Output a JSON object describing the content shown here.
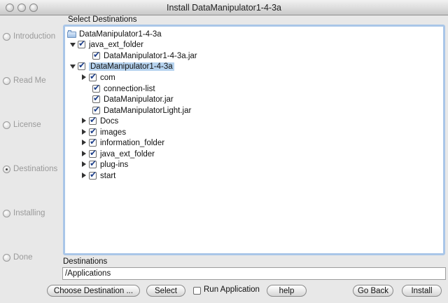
{
  "window": {
    "title": "Install DataManipulator1-4-3a"
  },
  "steps": [
    {
      "label": "Introduction",
      "selected": false
    },
    {
      "label": "Read Me",
      "selected": false
    },
    {
      "label": "License",
      "selected": false
    },
    {
      "label": "Destinations",
      "selected": true
    },
    {
      "label": "Installing",
      "selected": false
    },
    {
      "label": "Done",
      "selected": false
    }
  ],
  "tree": {
    "heading": "Select Destinations",
    "root_label": "DataManipulator1-4-3a",
    "items": [
      {
        "label": "java_ext_folder",
        "checked": true,
        "expander": "down"
      },
      {
        "label": "DataManipulator1-4-3a.jar",
        "checked": true,
        "expander": "none"
      },
      {
        "label": "DataManipulator1-4-3a",
        "checked": true,
        "expander": "down",
        "selected": true
      },
      {
        "label": "com",
        "checked": true,
        "expander": "right"
      },
      {
        "label": "connection-list",
        "checked": true,
        "expander": "none"
      },
      {
        "label": "DataManipulator.jar",
        "checked": true,
        "expander": "none"
      },
      {
        "label": "DataManipulatorLight.jar",
        "checked": true,
        "expander": "none"
      },
      {
        "label": "Docs",
        "checked": true,
        "expander": "right"
      },
      {
        "label": "images",
        "checked": true,
        "expander": "right"
      },
      {
        "label": "information_folder",
        "checked": true,
        "expander": "right"
      },
      {
        "label": "java_ext_folder",
        "checked": true,
        "expander": "right"
      },
      {
        "label": "plug-ins",
        "checked": true,
        "expander": "right"
      },
      {
        "label": "start",
        "checked": true,
        "expander": "right"
      }
    ]
  },
  "destinations": {
    "label": "Destinations",
    "value": "/Applications"
  },
  "buttons": {
    "choose_destination": "Choose Destination ...",
    "select": "Select",
    "run_application": "Run Application",
    "run_application_checked": false,
    "help": "help",
    "go_back": "Go Back",
    "install": "Install"
  }
}
